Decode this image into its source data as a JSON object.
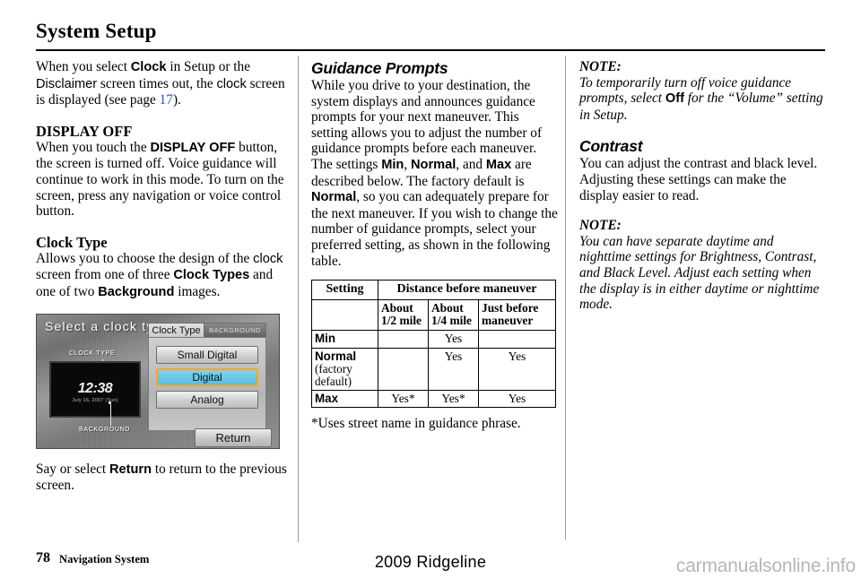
{
  "header": {
    "title": "System Setup"
  },
  "col1": {
    "intro": {
      "p1_a": "When you select ",
      "p1_clock": "Clock",
      "p1_b": " in Setup or the ",
      "p1_disclaimer": "Disclaimer",
      "p1_c": " screen times out, the ",
      "p1_clock2": "clock",
      "p1_d": " screen is displayed (see page ",
      "p1_page": "17",
      "p1_e": ")."
    },
    "display_off": {
      "heading": "DISPLAY OFF",
      "p_a": "When you touch the ",
      "p_btn": "DISPLAY OFF",
      "p_b": " button, the screen is turned off. Voice guidance will continue to work in this mode. To turn on the screen, press any navigation or voice control button."
    },
    "clock_type": {
      "heading": "Clock Type",
      "p_a": "Allows you to choose the design of the ",
      "p_clock": "clock",
      "p_b": " screen from one of three ",
      "p_ct": "Clock Types",
      "p_c": " and one of two ",
      "p_bg": "Background",
      "p_d": " images."
    },
    "nav_screen": {
      "title": "Select a clock type:",
      "callout_clock_type": "CLOCK TYPE",
      "callout_background": "BACKGROUND",
      "clock_time": "12:38",
      "clock_date": "July 16, 2007 (Sun)",
      "tab_active": "Clock Type",
      "tab_inactive": "BACKGROUND",
      "button_small_digital": "Small Digital",
      "button_digital": "Digital",
      "button_analog": "Analog",
      "button_return": "Return",
      "highlight_color": "#f5a623",
      "selected_fill": "#55c0e2"
    },
    "outro": {
      "p_a": "Say or select ",
      "p_return": "Return",
      "p_b": " to return to the previous screen."
    }
  },
  "col2": {
    "guidance": {
      "heading": "Guidance Prompts",
      "p_a": "While you drive to your destination, the system displays and announces guidance prompts for your next maneuver. This setting allows you to adjust the number of guidance prompts before each maneuver. The settings ",
      "p_min": "Min",
      "p_b": ", ",
      "p_normal": "Normal",
      "p_c": ", and ",
      "p_max": "Max",
      "p_d": " are described below. The factory default is ",
      "p_normal2": "Normal",
      "p_e": ", so you can adequately prepare for the next maneuver. If you wish to change the number of guidance prompts, select your preferred setting, as shown in the following table."
    },
    "table": {
      "header_setting": "Setting",
      "header_distance": "Distance before maneuver",
      "subheaders": [
        "",
        "About 1/2 mile",
        "About 1/4 mile",
        "Just before maneuver"
      ],
      "rows": [
        {
          "label": "Min",
          "sublabel": "",
          "cells": [
            "",
            "Yes",
            ""
          ]
        },
        {
          "label": "Normal",
          "sublabel": "(factory default)",
          "cells": [
            "",
            "Yes",
            "Yes"
          ]
        },
        {
          "label": "Max",
          "sublabel": "",
          "cells": [
            "Yes*",
            "Yes*",
            "Yes"
          ]
        }
      ]
    },
    "footnote": "*Uses street name in guidance phrase."
  },
  "col3": {
    "note1": {
      "label": "NOTE:",
      "p_a": "To temporarily turn off voice guidance prompts, select ",
      "p_off": "Off",
      "p_b": " for the “Volume” setting in Setup."
    },
    "contrast": {
      "heading": "Contrast",
      "p": "You can adjust the contrast and black level. Adjusting these settings can make the display easier to read."
    },
    "note2": {
      "label": "NOTE:",
      "p": "You can have separate daytime and nighttime settings for Brightness, Contrast, and Black Level. Adjust each setting when the display is in either daytime or nighttime mode."
    }
  },
  "footer": {
    "page_number": "78",
    "section": "Navigation System",
    "model": "2009  Ridgeline",
    "watermark": "carmanualsonline.info"
  }
}
